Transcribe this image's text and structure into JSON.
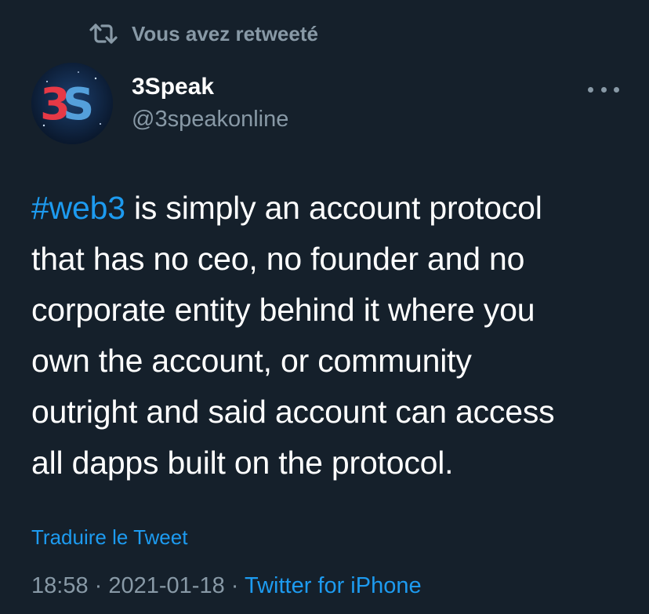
{
  "retweet_banner": {
    "icon": "retweet-icon",
    "text": "Vous avez retweeté"
  },
  "author": {
    "avatar_logo_text": "3S",
    "display_name": "3Speak",
    "handle": "@3speakonline"
  },
  "more_menu": {
    "icon": "more-dots-icon"
  },
  "tweet": {
    "hashtag": "#web3",
    "line1_rest": " is simply an account protocol",
    "line2": "that has no ceo, no founder and no",
    "line3": "corporate entity behind it where you",
    "line4": "own the account, or community",
    "line5": "outright and said account can access",
    "line6": "all dapps built on the protocol."
  },
  "translate_label": "Traduire le Tweet",
  "meta": {
    "time": "18:58",
    "sep1": " · ",
    "date": "2021-01-18",
    "sep2": " · ",
    "source": "Twitter for iPhone"
  },
  "colors": {
    "background": "#15202b",
    "secondary_text": "#8899a6",
    "link": "#1d9bf0",
    "logo_red": "#e63946",
    "logo_blue": "#5aa9e6"
  }
}
